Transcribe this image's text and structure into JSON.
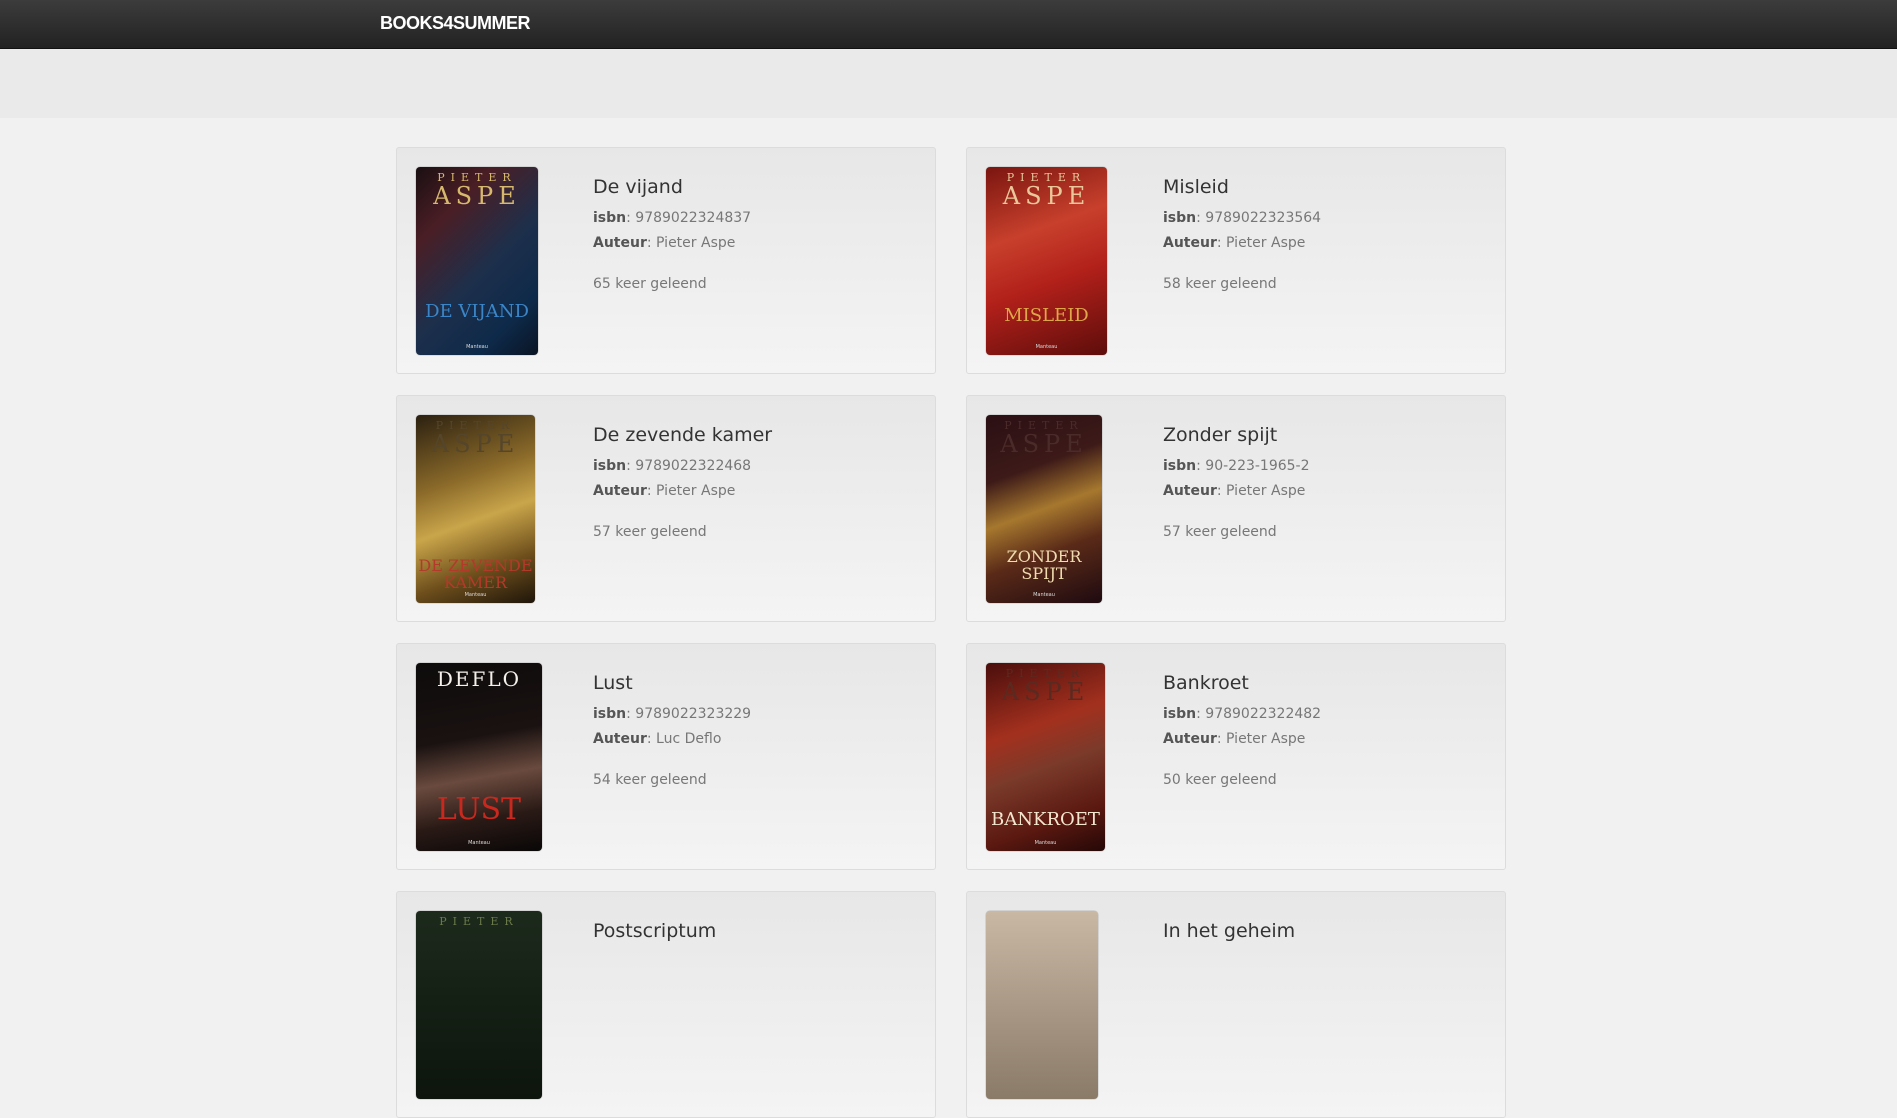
{
  "brand": "BOOKS4SUMMER",
  "labels": {
    "isbn": "isbn",
    "author": "Auteur"
  },
  "books": [
    {
      "title": "De vijand",
      "isbn": "9789022324837",
      "author": "Pieter Aspe",
      "loans": "65 keer geleend",
      "cover": {
        "top_small": "PIETER",
        "top_big": "ASPE",
        "title": "DE VIJAND",
        "publisher": "Manteau",
        "bg": "linear-gradient(135deg,#1a0f12 0%,#4a1e25 25%,#1d2f4b 55%,#0e2a4a 80%,#0a1424 100%)",
        "top_color": "#d6b86e",
        "title_color": "#3b86c8"
      }
    },
    {
      "title": "Misleid",
      "isbn": "9789022323564",
      "author": "Pieter Aspe",
      "loans": "58 keer geleend",
      "cover": {
        "top_small": "PIETER",
        "top_big": "ASPE",
        "title": "MISLEID",
        "publisher": "Manteau",
        "bg": "linear-gradient(160deg,#7a1510 0%,#c8402c 35%,#b2201a 60%,#5d0d0b 100%)",
        "top_color": "#e9c79a",
        "title_color": "#e0a64a"
      }
    },
    {
      "title": "De zevende kamer",
      "isbn": "9789022322468",
      "author": "Pieter Aspe",
      "loans": "57 keer geleend",
      "cover": {
        "top_small": "PIETER",
        "top_big": "ASPE",
        "title": "DE ZEVENDE KAMER",
        "publisher": "Manteau",
        "bg": "linear-gradient(160deg,#2b2010 0%,#8c6b2a 35%,#c9a54a 55%,#6e4f1c 78%,#1e150a 100%)",
        "top_color": "#55452a",
        "title_color": "#b33a2a"
      }
    },
    {
      "title": "Zonder spijt",
      "isbn": "90-223-1965-2",
      "author": "Pieter Aspe",
      "loans": "57 keer geleend",
      "cover": {
        "top_small": "PIETER",
        "top_big": "ASPE",
        "title": "ZONDER SPIJT",
        "publisher": "Manteau",
        "bg": "linear-gradient(160deg,#2a0f14 0%,#3d1a18 30%,#a6782e 50%,#5a2a18 70%,#1e0a10 100%)",
        "top_color": "#4b2a2a",
        "title_color": "#f0dcb0"
      }
    },
    {
      "title": "Lust",
      "isbn": "9789022323229",
      "author": "Luc Deflo",
      "loans": "54 keer geleend",
      "cover": {
        "top_small": "",
        "top_big": "DEFLO",
        "title": "LUST",
        "publisher": "Manteau",
        "bg": "linear-gradient(170deg,#0d0b0b 0%,#1a1211 40%,#6a4a3e 60%,#2a1a16 80%,#090707 100%)",
        "top_color": "#f5f0ea",
        "title_color": "#c8281e"
      }
    },
    {
      "title": "Bankroet",
      "isbn": "9789022322482",
      "author": "Pieter Aspe",
      "loans": "50 keer geleend",
      "cover": {
        "top_small": "PIETER",
        "top_big": "ASPE",
        "title": "BANKROET",
        "publisher": "Manteau",
        "bg": "linear-gradient(160deg,#4a0e0c 0%,#a3301e 35%,#7a3a2a 55%,#5a1810 80%,#250807 100%)",
        "top_color": "#5a2a20",
        "title_color": "#f3e6cf"
      }
    },
    {
      "title": "Postscriptum",
      "isbn": "",
      "author": "",
      "loans": "",
      "cover": {
        "top_small": "PIETER",
        "top_big": "",
        "title": "",
        "publisher": "",
        "bg": "linear-gradient(180deg,#1c2a1c 0%,#0d150d 100%)",
        "top_color": "#6a7a4a",
        "title_color": "#ccc"
      }
    },
    {
      "title": "In het geheim",
      "isbn": "",
      "author": "",
      "loans": "",
      "cover": {
        "top_small": "",
        "top_big": "",
        "title": "",
        "publisher": "",
        "bg": "linear-gradient(180deg,#c9b8a4 0%,#8a7a68 100%)",
        "top_color": "#333",
        "title_color": "#ccc"
      }
    }
  ]
}
